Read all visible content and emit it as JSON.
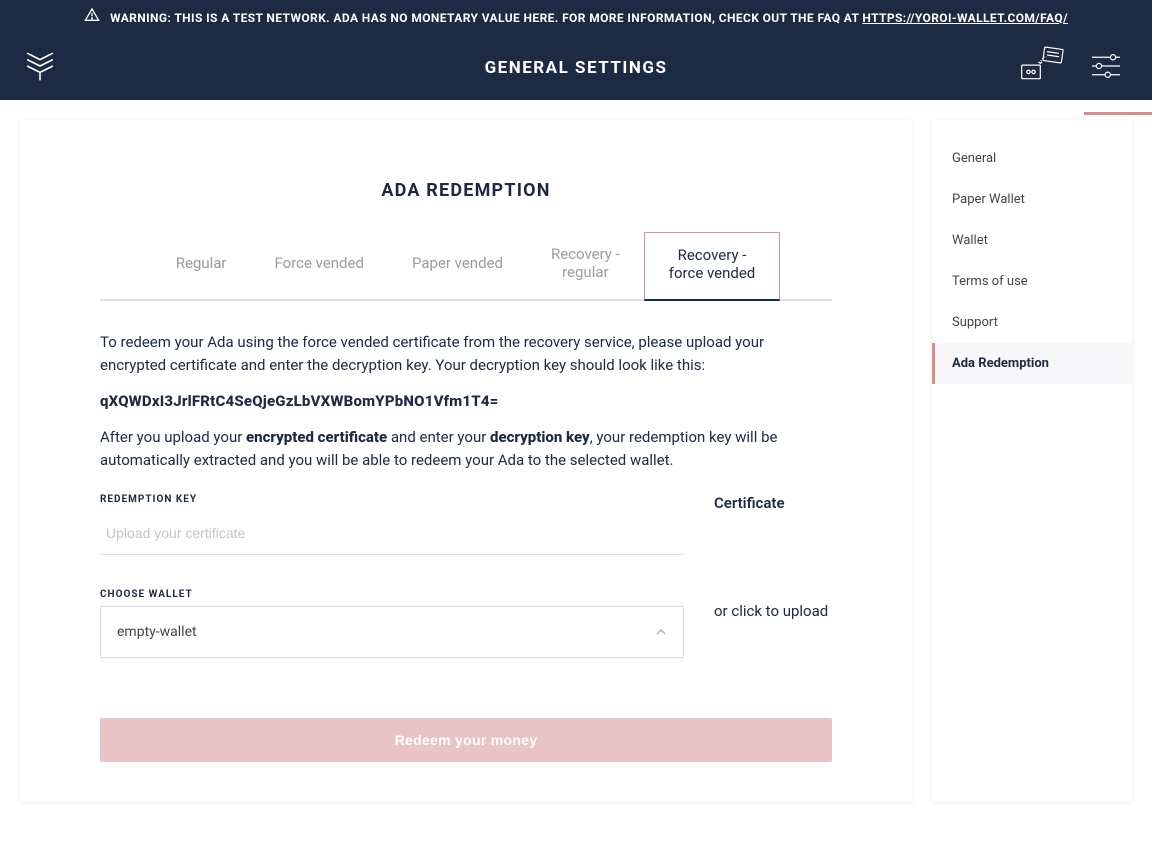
{
  "warning": {
    "prefix": "WARNING: THIS IS A TEST NETWORK. ADA HAS NO MONETARY VALUE HERE. FOR MORE INFORMATION, CHECK OUT THE FAQ AT ",
    "link_text": "HTTPS://YOROI-WALLET.COM/FAQ/"
  },
  "header": {
    "title": "GENERAL SETTINGS"
  },
  "main": {
    "title": "ADA REDEMPTION",
    "tabs": [
      {
        "label": "Regular"
      },
      {
        "label": "Force vended"
      },
      {
        "label": "Paper vended"
      },
      {
        "label_l1": "Recovery -",
        "label_l2": "regular"
      },
      {
        "label_l1": "Recovery -",
        "label_l2": "force vended"
      }
    ],
    "active_tab_index": 4,
    "copy_p1": "To redeem your Ada using the force vended certificate from the recovery service, please upload your encrypted certificate and enter the decryption key. Your decryption key should look like this:",
    "sample_key": "qXQWDxI3JrlFRtC4SeQjeGzLbVXWBomYPbNO1Vfm1T4=",
    "copy_p2_a": "After you upload your ",
    "copy_p2_b_bold": "encrypted certificate",
    "copy_p2_c": " and enter your ",
    "copy_p2_d_bold": "decryption key",
    "copy_p2_e": ", your redemption key will be automatically extracted and you will be able to redeem your Ada to the selected wallet.",
    "redemption_key": {
      "label": "REDEMPTION KEY",
      "placeholder": "Upload your certificate",
      "value": ""
    },
    "choose_wallet": {
      "label": "CHOOSE WALLET",
      "selected": "empty-wallet"
    },
    "upload": {
      "title": "Certificate",
      "hint": "or click to upload"
    },
    "redeem_button": "Redeem your money"
  },
  "sidebar": {
    "items": [
      {
        "label": "General"
      },
      {
        "label": "Paper Wallet"
      },
      {
        "label": "Wallet"
      },
      {
        "label": "Terms of use"
      },
      {
        "label": "Support"
      },
      {
        "label": "Ada Redemption"
      }
    ],
    "active_index": 5
  },
  "colors": {
    "navy": "#1c2a42",
    "accent": "#da8b8b",
    "accent_faded": "#e8c4c4"
  }
}
